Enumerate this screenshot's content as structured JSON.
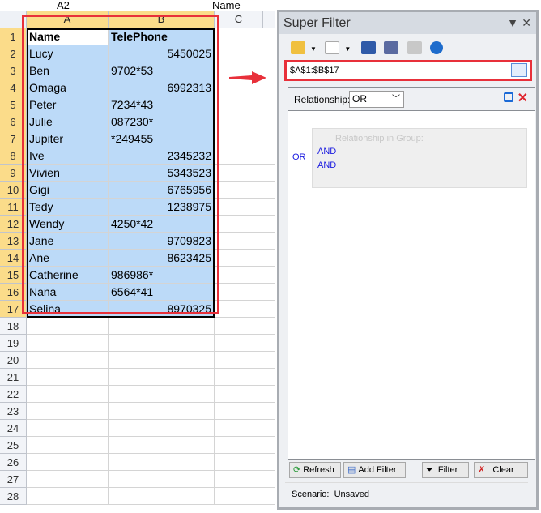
{
  "formula_bar": {
    "name_box": "A2",
    "formula": "Name"
  },
  "sheet": {
    "columns": [
      "A",
      "B",
      "C"
    ],
    "row_count": 28,
    "header": [
      "Name",
      "TelePhone"
    ],
    "rows": [
      [
        "Lucy",
        "5450025"
      ],
      [
        "Ben",
        "9702*53"
      ],
      [
        "Omaga",
        "6992313"
      ],
      [
        "Peter",
        "7234*43"
      ],
      [
        "Julie",
        "087230*"
      ],
      [
        "Jupiter",
        "*249455"
      ],
      [
        "Ive",
        "2345232"
      ],
      [
        "Vivien",
        "5343523"
      ],
      [
        "Gigi",
        "6765956"
      ],
      [
        "Tedy",
        "1238975"
      ],
      [
        "Wendy",
        "4250*42"
      ],
      [
        "Jane",
        "9709823"
      ],
      [
        "Ane",
        "8623425"
      ],
      [
        "Catherine",
        "986986*"
      ],
      [
        "Nana",
        "6564*41"
      ],
      [
        "Selina",
        "8970325"
      ]
    ]
  },
  "panel": {
    "title": "Super Filter",
    "range": "$A$1:$B$17",
    "relationship_label": "Relationship:",
    "relationship_value": "OR",
    "outer_relation": "OR",
    "group_title": "Relationship in Group:",
    "group_relations": [
      "AND",
      "AND"
    ],
    "buttons": {
      "refresh": "Refresh",
      "add_filter": "Add Filter",
      "filter": "Filter",
      "clear": "Clear"
    },
    "scenario_label": "Scenario:",
    "scenario_value": "Unsaved"
  },
  "colors": {
    "highlight": "#e8303a",
    "selection": "#bcdaf8",
    "header_selected": "#fbdc8a",
    "link_blue": "#1a1ae0"
  }
}
